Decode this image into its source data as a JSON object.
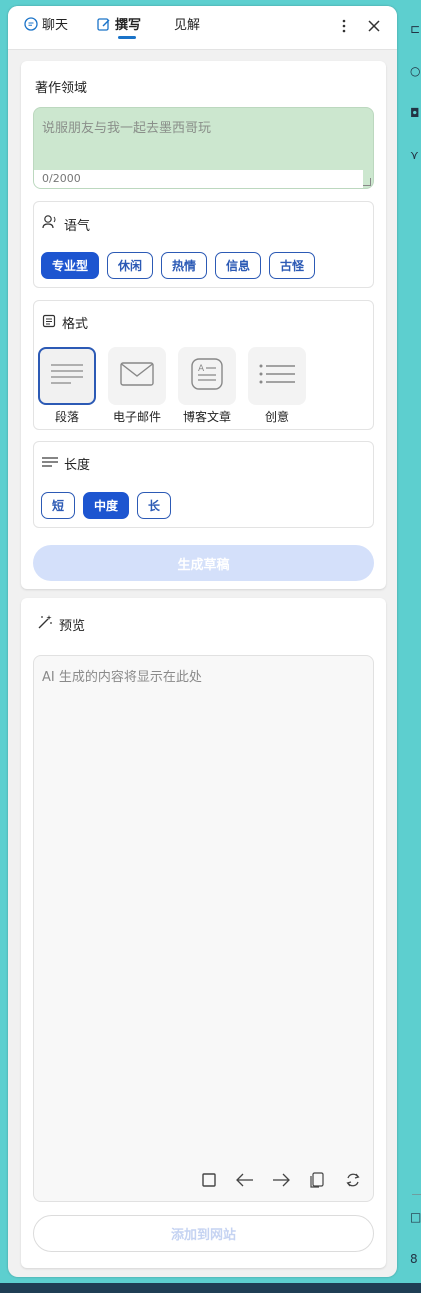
{
  "header": {
    "tabs": [
      {
        "label": "聊天",
        "icon": "chat-bubble-icon",
        "active": false
      },
      {
        "label": "撰写",
        "icon": "compose-icon",
        "active": true
      },
      {
        "label": "见解",
        "icon": "",
        "active": false
      }
    ],
    "more_icon": "more-vertical-icon",
    "close_icon": "close-icon"
  },
  "compose": {
    "topic_label": "著作领域",
    "topic_placeholder": "说服朋友与我一起去墨西哥玩",
    "topic_value": "",
    "char_count": "0/2000",
    "tone": {
      "label": "语气",
      "icon": "voice-icon",
      "options": [
        "专业型",
        "休闲",
        "热情",
        "信息",
        "古怪"
      ],
      "selected": "专业型"
    },
    "format": {
      "label": "格式",
      "icon": "document-icon",
      "options": [
        {
          "label": "段落",
          "icon": "paragraph-icon"
        },
        {
          "label": "电子邮件",
          "icon": "email-icon"
        },
        {
          "label": "博客文章",
          "icon": "blog-post-icon"
        },
        {
          "label": "创意",
          "icon": "ideas-list-icon"
        }
      ],
      "selected": "段落"
    },
    "length": {
      "label": "长度",
      "icon": "lines-icon",
      "options": [
        "短",
        "中度",
        "长"
      ],
      "selected": "中度"
    },
    "generate_label": "生成草稿"
  },
  "preview": {
    "label": "预览",
    "icon": "magic-wand-icon",
    "placeholder": "AI 生成的内容将显示在此处",
    "tools": [
      "stop-icon",
      "back-arrow-icon",
      "forward-arrow-icon",
      "copy-icon",
      "regenerate-icon"
    ],
    "add_to_site_label": "添加到网站"
  },
  "colors": {
    "accent": "#1d55d0",
    "chip_border": "#2c5ab5",
    "topic_bg": "#cce7cf",
    "background": "#5dcfcf"
  }
}
